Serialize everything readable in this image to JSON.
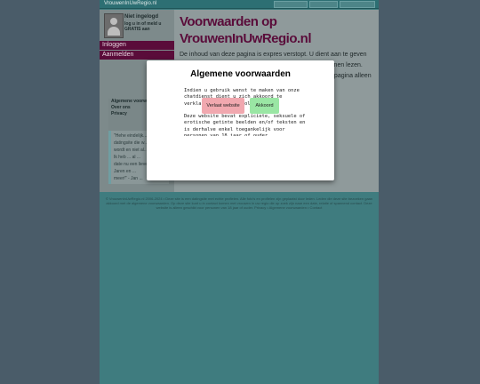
{
  "site": {
    "brand": "VrouwenInUwRegio.nl"
  },
  "sidebar": {
    "status_title": "Niet ingelogd",
    "status_sub": "log u in of meld u GRATIS aan",
    "menu": [
      "Inloggen",
      "Aanmelden"
    ],
    "links": [
      "Algemene voorw...",
      "Over ons",
      "Privacy"
    ],
    "quote_lines": [
      "\"Hehe eindelijk...",
      "datingsite die w...",
      "wordt en niet al...",
      "Ik heb ... al ...",
      "date nu een lieve...",
      "Jaren en ...",
      "meer!\" - Jan ..."
    ]
  },
  "main": {
    "title": "Voorwaarden op VrouwenInUwRegio.nl",
    "body": "De inhoud van deze pagina is expres verstopt. U dient aan te geven dat u akkoord gaat met de voorwaarden om deze te kunnen lezen. Accordeer u de voorwaarden en ga verder. U kunt deze pagina alleen bekijken als u akkoord bent. Of ..."
  },
  "copyright": "© VrouwenInUwRegio.nl 2006-2024 • Deze site is een datingsite met echte profielen. Alle foto's en profielen zijn geplaatst door leden. Leden die deze site bezoeken gaan akkoord met de algemene voorwaarden. Op deze site kunt u in contact komen met vrouwen in uw regio die op zoek zijn naar een date, relatie of spannend contact. Deze website is alleen geschikt voor personen van 18 jaar of ouder. Privacy • Algemene voorwaarden • Contact",
  "modal": {
    "title": "Algemene voorwaarden",
    "text": "Indien u gebruik wenst te maken van onze chatdienst dient u zich akkoord te verklaren met het navolgende:\n\nDeze website bevat expliciete, seksuele of erotische getinte beelden en/of teksten en is derhalve enkel toegankelijk voor personen van 18 jaar of ouder. Minderjarigen dienen deze website te verlaten. Deze website is",
    "leave_label": "Verlaat website",
    "accept_label": "Akkoord",
    "leave_color": "#f1a8af",
    "accept_color": "#9ae6a4"
  }
}
